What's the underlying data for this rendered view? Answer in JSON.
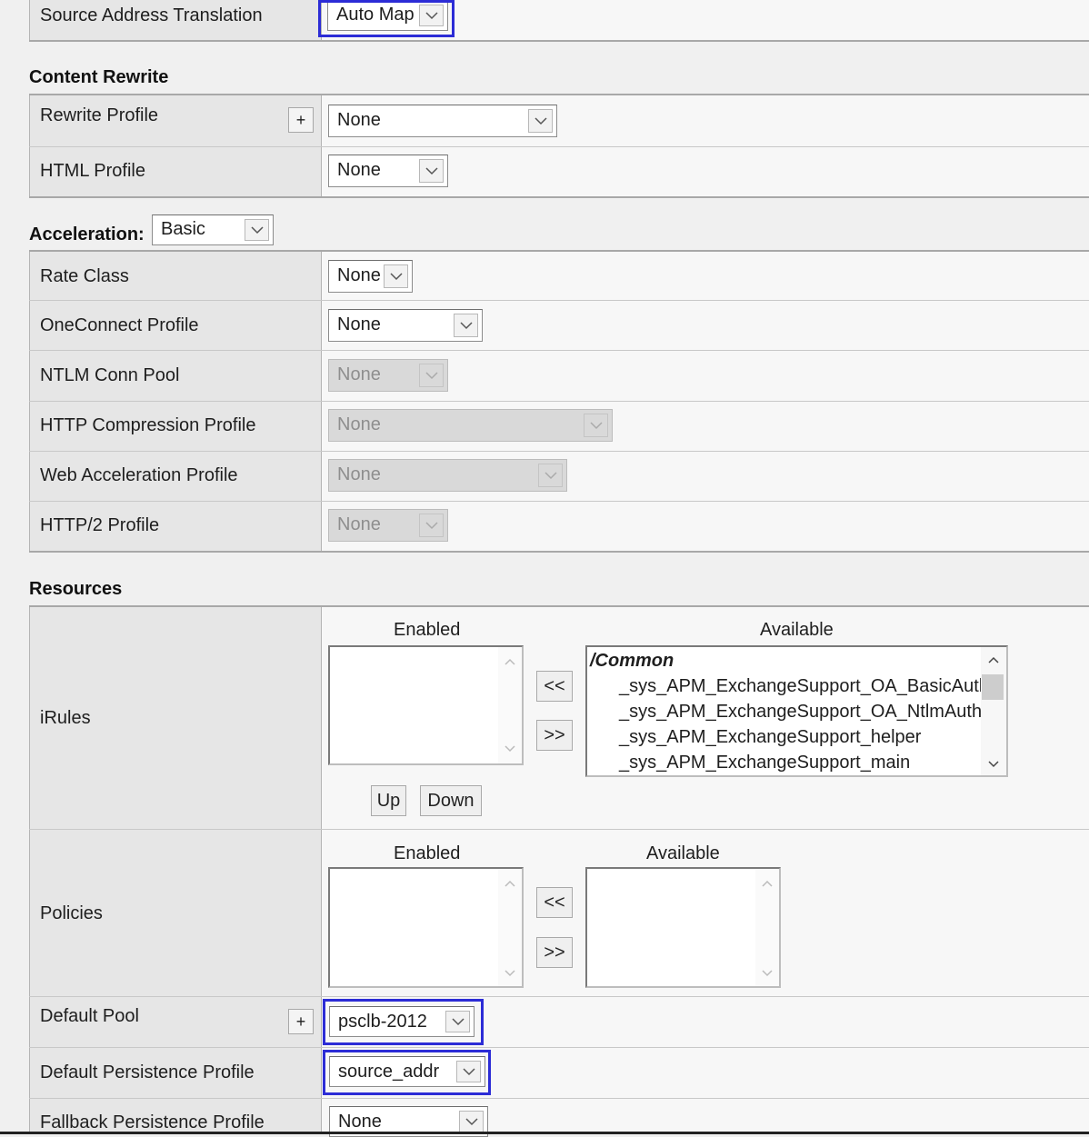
{
  "source_address_translation": {
    "label": "Source Address Translation",
    "value": "Auto Map"
  },
  "content_rewrite": {
    "title": "Content Rewrite",
    "rewrite_profile": {
      "label": "Rewrite Profile",
      "value": "None",
      "add": "+"
    },
    "html_profile": {
      "label": "HTML Profile",
      "value": "None"
    }
  },
  "acceleration": {
    "title": "Acceleration:",
    "mode": "Basic",
    "rate_class": {
      "label": "Rate Class",
      "value": "None"
    },
    "oneconnect_profile": {
      "label": "OneConnect Profile",
      "value": "None"
    },
    "ntlm_conn_pool": {
      "label": "NTLM Conn Pool",
      "value": "None"
    },
    "http_compression_profile": {
      "label": "HTTP Compression Profile",
      "value": "None"
    },
    "web_acceleration_profile": {
      "label": "Web Acceleration Profile",
      "value": "None"
    },
    "http2_profile": {
      "label": "HTTP/2 Profile",
      "value": "None"
    }
  },
  "resources": {
    "title": "Resources",
    "irules": {
      "label": "iRules",
      "enabled_header": "Enabled",
      "available_header": "Available",
      "move_left": "<<",
      "move_right": ">>",
      "up": "Up",
      "down": "Down",
      "available_group": "/Common",
      "available_items": [
        "_sys_APM_ExchangeSupport_OA_BasicAuth",
        "_sys_APM_ExchangeSupport_OA_NtlmAuth",
        "_sys_APM_ExchangeSupport_helper",
        "_sys_APM_ExchangeSupport_main"
      ]
    },
    "policies": {
      "label": "Policies",
      "enabled_header": "Enabled",
      "available_header": "Available",
      "move_left": "<<",
      "move_right": ">>"
    },
    "default_pool": {
      "label": "Default Pool",
      "value": "psclb-2012",
      "add": "+"
    },
    "default_persistence_profile": {
      "label": "Default Persistence Profile",
      "value": "source_addr"
    },
    "fallback_persistence_profile": {
      "label": "Fallback Persistence Profile",
      "value": "None"
    }
  },
  "colors": {
    "highlight": "#2c2cd6",
    "label_bg": "#e6e6e6",
    "value_bg": "#f7f7f7"
  }
}
